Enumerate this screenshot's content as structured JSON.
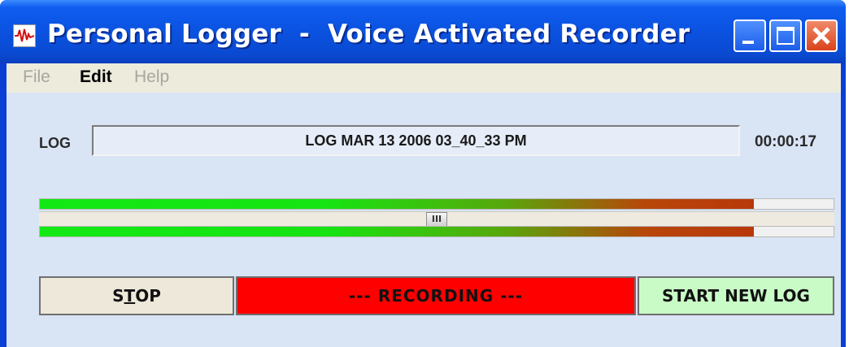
{
  "window": {
    "title": "Personal Logger  -  Voice Activated Recorder"
  },
  "menu": [
    {
      "label": "File",
      "enabled": false
    },
    {
      "label": "Edit",
      "enabled": true
    },
    {
      "label": "Help",
      "enabled": false
    }
  ],
  "log": {
    "label": "LOG",
    "name": "LOG  MAR 13 2006  03_40_33 PM",
    "elapsed": "00:00:17"
  },
  "meters": {
    "level_top": 0.9,
    "level_bottom": 0.9,
    "threshold": 0.5
  },
  "slider": {
    "thumb_label": "III"
  },
  "buttons": {
    "stop": "STOP",
    "status": "---  RECORDING  ---",
    "new_log": "START NEW LOG"
  },
  "colors": {
    "recording": "#ff0000",
    "new_log": "#c9fbc6",
    "meter_start": "#13e815",
    "meter_end": "#b8380a"
  },
  "icons": [
    "app-waveform-icon",
    "minimize-icon",
    "maximize-icon",
    "close-icon"
  ]
}
